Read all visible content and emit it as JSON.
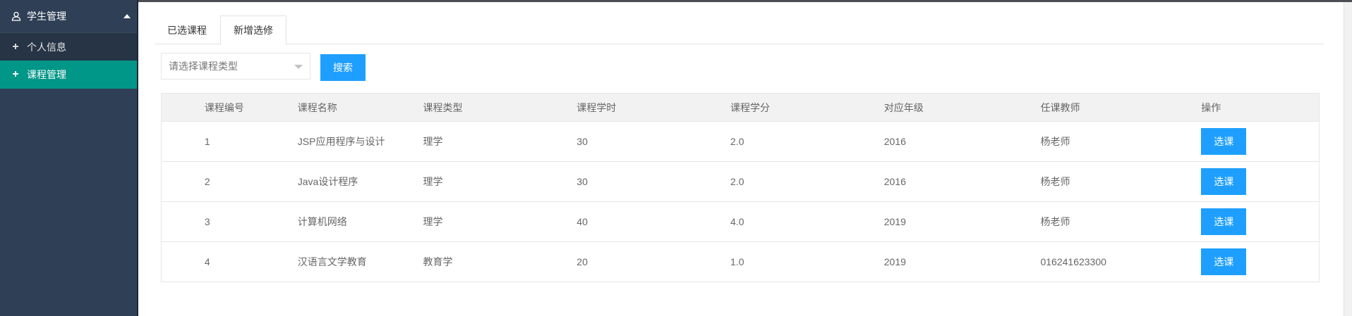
{
  "sidebar": {
    "title": "学生管理",
    "items": [
      {
        "label": "个人信息"
      },
      {
        "label": "课程管理"
      }
    ]
  },
  "tabs": [
    "已选课程",
    "新增选修"
  ],
  "filter": {
    "placeholder": "请选择课程类型",
    "search_label": "搜索"
  },
  "table": {
    "headers": [
      "课程编号",
      "课程名称",
      "课程类型",
      "课程学时",
      "课程学分",
      "对应年级",
      "任课教师",
      "操作"
    ],
    "rows": [
      {
        "id": "1",
        "name": "JSP应用程序与设计",
        "type": "理学",
        "hours": "30",
        "credit": "2.0",
        "grade": "2016",
        "teacher": "杨老师",
        "action": "选课"
      },
      {
        "id": "2",
        "name": "Java设计程序",
        "type": "理学",
        "hours": "30",
        "credit": "2.0",
        "grade": "2016",
        "teacher": "杨老师",
        "action": "选课"
      },
      {
        "id": "3",
        "name": "计算机网络",
        "type": "理学",
        "hours": "40",
        "credit": "4.0",
        "grade": "2019",
        "teacher": "杨老师",
        "action": "选课"
      },
      {
        "id": "4",
        "name": "汉语言文学教育",
        "type": "教育学",
        "hours": "20",
        "credit": "1.0",
        "grade": "2019",
        "teacher": "016241623300",
        "action": "选课"
      }
    ]
  },
  "icons": {
    "sidebar_header": "user-icon",
    "collapse": "caret-up-icon",
    "sub_items": "plus-icon",
    "select": "dropdown-arrow-icon"
  },
  "colors": {
    "sidebar_bg": "#2f4056",
    "active_item": "#009688",
    "primary_button": "#1e9fff"
  }
}
